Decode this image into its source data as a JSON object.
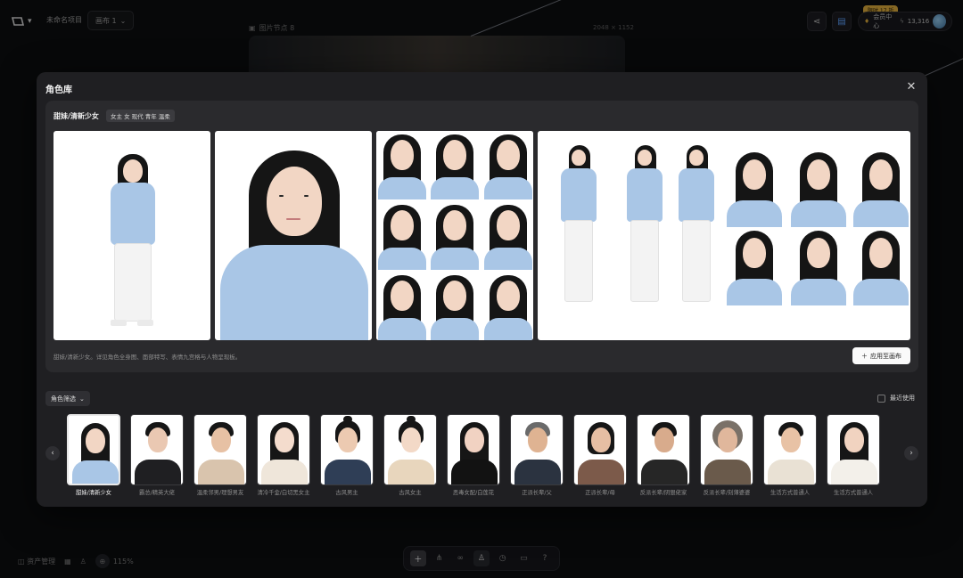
{
  "header": {
    "project_title": "未命名项目",
    "canvas_select": "画布 1",
    "node_label": "图片节点 8",
    "node_size": "2048 × 1152",
    "promo_badge": "限时 17 折",
    "member_label": "会员中心",
    "credits": "13,316"
  },
  "footer": {
    "asset_manager": "资产管理",
    "zoom": "115%"
  },
  "modal": {
    "title": "角色库",
    "close_icon": "close-icon",
    "character": {
      "name": "甜妹/清新少女",
      "tags": "女主 女 现代 青年 温柔",
      "description": "甜妹/清新少女。详见角色全身图、面部特写、表情九宫格与人物呈现板。",
      "apply_label": "应用至画布"
    },
    "filter_label": "角色筛选",
    "recent_label": "最近使用",
    "characters": [
      {
        "label": "甜妹/清新少女",
        "selected": true,
        "hair": "long",
        "skin": "#f2d6c4",
        "outfit": "#a9c6e6"
      },
      {
        "label": "霸总/精英大佬",
        "selected": false,
        "hair": "short",
        "skin": "#eac8b2",
        "outfit": "#1f1f22"
      },
      {
        "label": "温柔邻男/理想男友",
        "selected": false,
        "hair": "short",
        "skin": "#e7c1a4",
        "outfit": "#d9c4ad"
      },
      {
        "label": "清冷千金/白切黑女主",
        "selected": false,
        "hair": "long",
        "skin": "#f4dccd",
        "outfit": "#efe6da"
      },
      {
        "label": "古风男主",
        "selected": false,
        "hair": "bun",
        "skin": "#eccab1",
        "outfit": "#2f3e56"
      },
      {
        "label": "古风女主",
        "selected": false,
        "hair": "bun",
        "skin": "#f3d9c7",
        "outfit": "#e8d6bd"
      },
      {
        "label": "恶毒女配/白莲花",
        "selected": false,
        "hair": "long",
        "skin": "#f1d2c2",
        "outfit": "#121212"
      },
      {
        "label": "正派长辈/父",
        "selected": false,
        "hair": "gray",
        "skin": "#dfb392",
        "outfit": "#2b3340"
      },
      {
        "label": "正派长辈/母",
        "selected": false,
        "hair": "bob",
        "skin": "#e6bea3",
        "outfit": "#7c5a4a"
      },
      {
        "label": "反派长辈/阴狠佬家",
        "selected": false,
        "hair": "short",
        "skin": "#d8ab8c",
        "outfit": "#262626"
      },
      {
        "label": "反派长辈/刻薄婆婆",
        "selected": false,
        "hair": "curly",
        "skin": "#e0b79c",
        "outfit": "#6a5a4b"
      },
      {
        "label": "生活方式普通人",
        "selected": false,
        "hair": "short",
        "skin": "#e8c2a5",
        "outfit": "#e9e1d4"
      },
      {
        "label": "生活方式普通人",
        "selected": false,
        "hair": "long",
        "skin": "#f1d3c0",
        "outfit": "#f3f0ea"
      }
    ]
  },
  "colors": {
    "modal_bg": "#1f1f22",
    "panel_bg": "#2a2a2d",
    "accent_blue": "#5ea2ff",
    "promo_gold": "#d9a93a"
  }
}
